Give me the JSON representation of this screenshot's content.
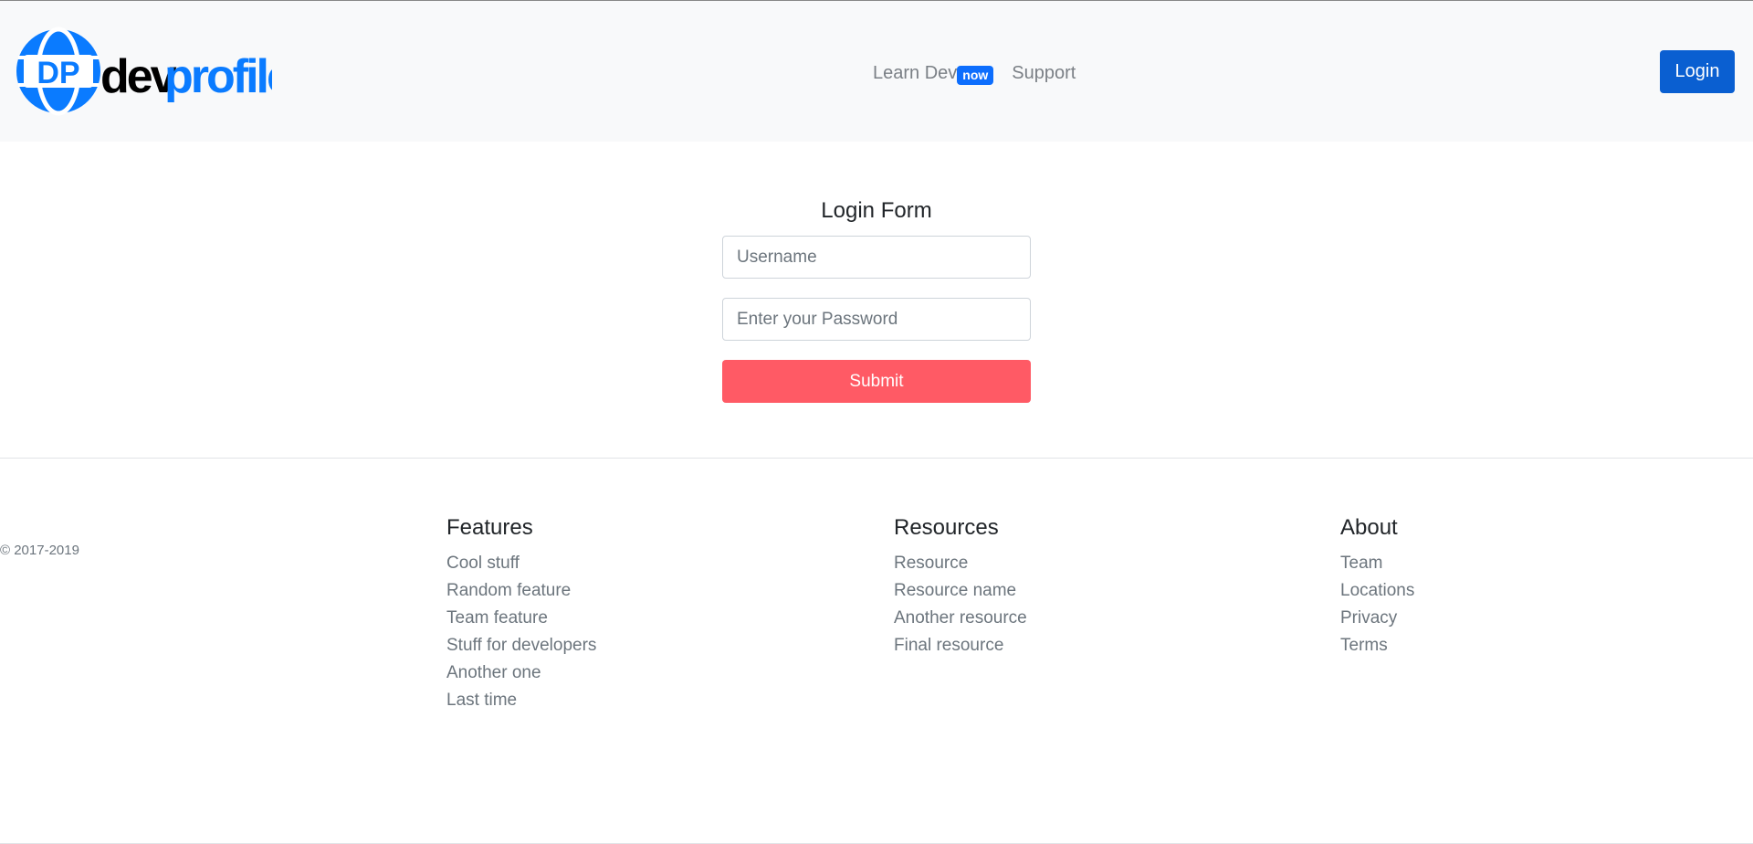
{
  "header": {
    "logo_text_dark": "dev",
    "logo_text_blue": "profile",
    "logo_mark": "DP",
    "nav": [
      {
        "label": "Learn Dev",
        "badge": "now"
      },
      {
        "label": "Support"
      }
    ],
    "login_label": "Login"
  },
  "form": {
    "title": "Login Form",
    "username_placeholder": "Username",
    "password_placeholder": "Enter your Password",
    "submit_label": "Submit"
  },
  "footer": {
    "copyright": "© 2017-2019",
    "columns": [
      {
        "heading": "Features",
        "links": [
          "Cool stuff",
          "Random feature",
          "Team feature",
          "Stuff for developers",
          "Another one",
          "Last time"
        ]
      },
      {
        "heading": "Resources",
        "links": [
          "Resource",
          "Resource name",
          "Another resource",
          "Final resource"
        ]
      },
      {
        "heading": "About",
        "links": [
          "Team",
          "Locations",
          "Privacy",
          "Terms"
        ]
      }
    ]
  },
  "colors": {
    "brand_blue": "#0a7bff",
    "login_button": "#0a5fd1",
    "submit_button": "#ff5a65",
    "badge": "#0d6efd"
  }
}
